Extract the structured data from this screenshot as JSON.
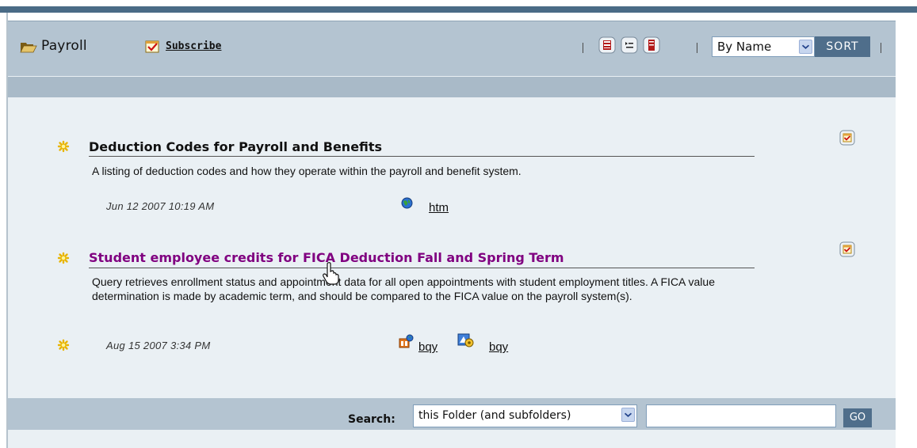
{
  "header": {
    "title": "Payroll",
    "subscribe_label": "Subscribe",
    "sort_select_value": "By Name",
    "sort_button_label": "SORT"
  },
  "toolbar": {
    "icons": [
      "view-list-icon",
      "view-details-icon",
      "view-summary-icon"
    ]
  },
  "items": [
    {
      "title": "Deduction Codes for Payroll and Benefits",
      "description": "A listing of deduction codes and how they operate within the payroll and benefit system.",
      "date": "Jun 12 2007  10:19 AM",
      "files": [
        {
          "label": "htm",
          "icon": "globe-icon"
        }
      ],
      "title_color": "#111111"
    },
    {
      "title": "Student employee credits for FICA Deduction Fall and Spring Term",
      "description": "Query retrieves enrollment status and appointment data for all open appointments with student employment titles. A FICA value determination is made by academic term, and should be compared to the FICA value on the payroll system(s).",
      "date": "Aug 15 2007  3:34 PM",
      "files": [
        {
          "label": "bqy",
          "icon": "bqy-icon"
        },
        {
          "label": "bqy",
          "icon": "bqy-process-icon"
        }
      ],
      "title_color": "#800080"
    }
  ],
  "search": {
    "label": "Search:",
    "scope_value": "this Folder (and subfolders)",
    "input_value": "",
    "go_label": "GO"
  },
  "colors": {
    "accent": "#4f6e8b",
    "header_bg": "#b4c4d1",
    "panel_bg": "#eaf0f4",
    "visited_link": "#800080"
  }
}
